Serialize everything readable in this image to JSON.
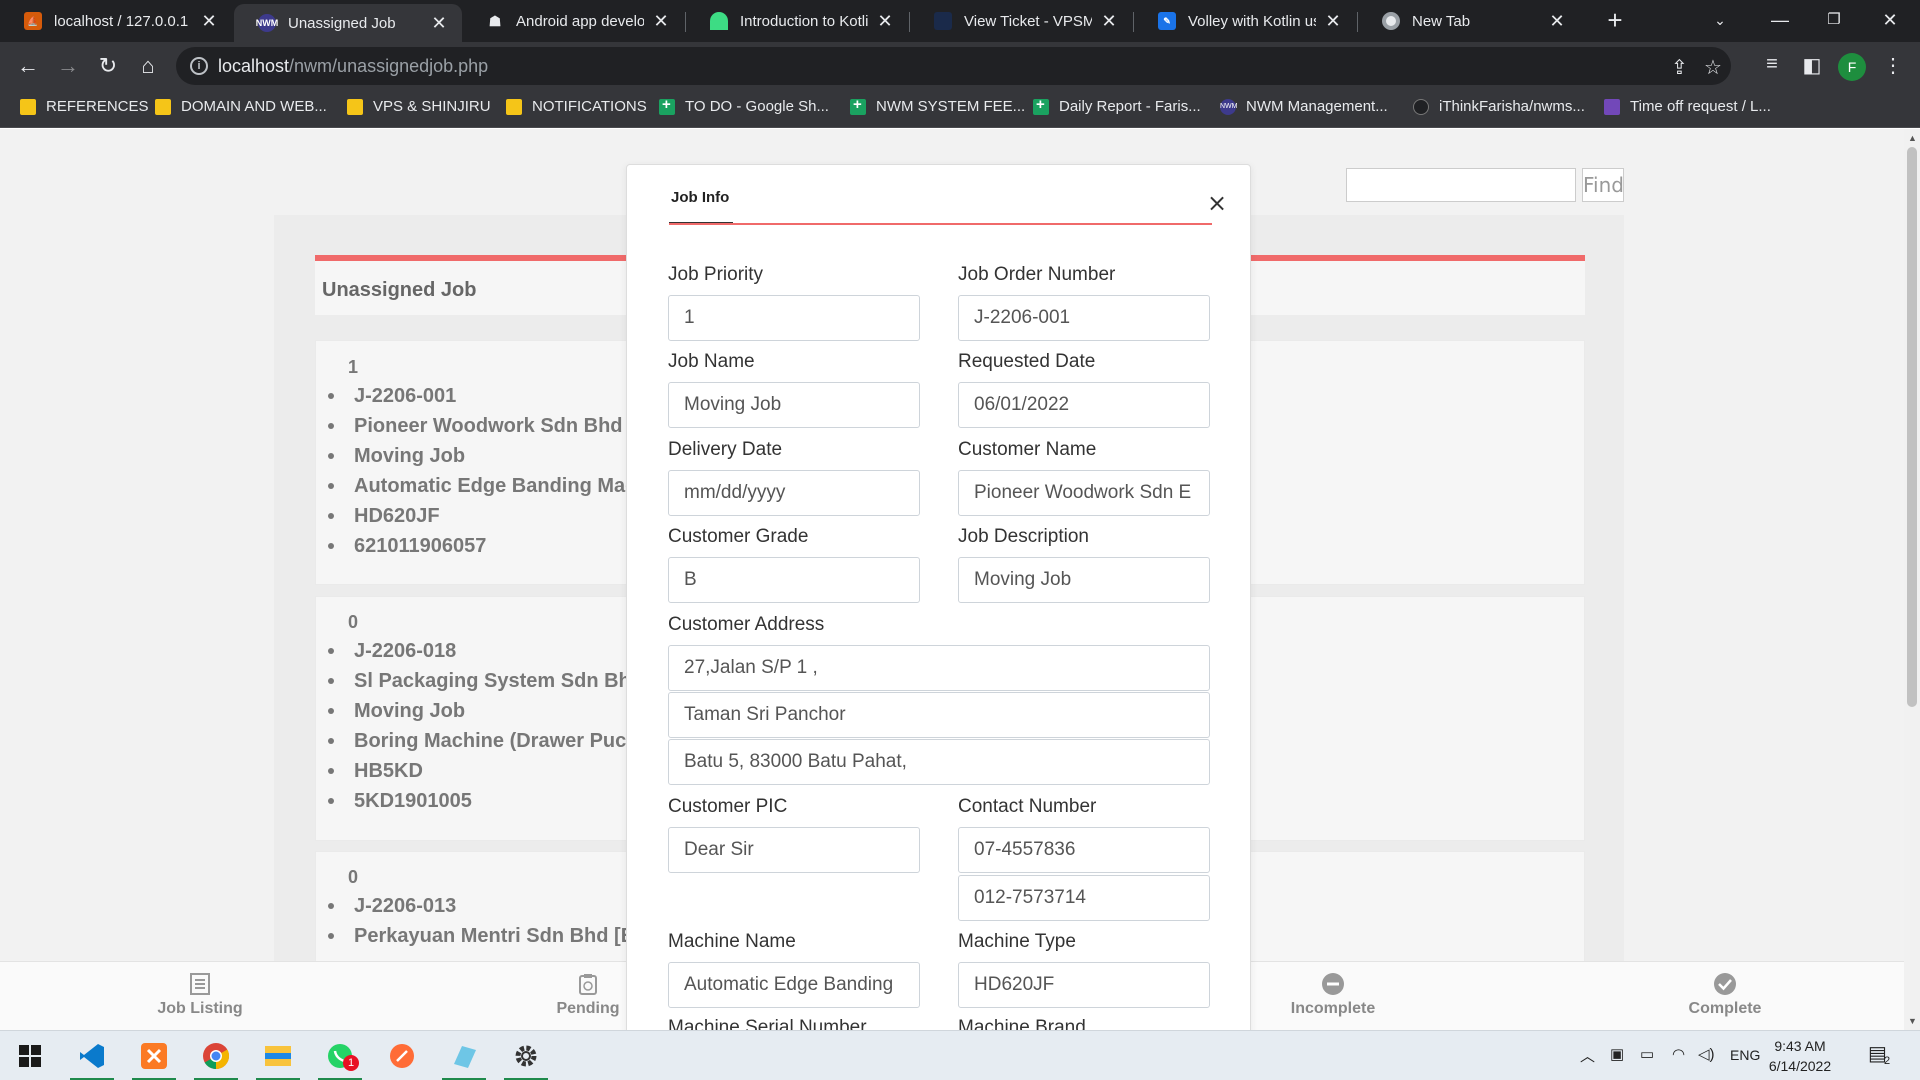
{
  "browser": {
    "tabs": [
      {
        "title": "localhost / 127.0.0.1 /",
        "favicon": "phpmyadmin-icon",
        "active": false
      },
      {
        "title": "Unassigned Job",
        "favicon": "nwm-icon",
        "active": true
      },
      {
        "title": "Android app developr",
        "favicon": "android-icon",
        "active": false
      },
      {
        "title": "Introduction to Kotlin",
        "favicon": "android-studio-icon",
        "active": false
      },
      {
        "title": "View Ticket - VPSMala",
        "favicon": "vps-icon",
        "active": false
      },
      {
        "title": "Volley with Kotlin usin",
        "favicon": "volley-icon",
        "active": false
      },
      {
        "title": "New Tab",
        "favicon": "chrome-icon",
        "active": false
      }
    ],
    "url_host": "localhost",
    "url_path": "/nwm/unassignedjob.php",
    "profile_initial": "F",
    "bookmarks": [
      {
        "label": "REFERENCES",
        "type": "folder"
      },
      {
        "label": "DOMAIN AND WEB...",
        "type": "folder"
      },
      {
        "label": "VPS & SHINJIRU",
        "type": "folder"
      },
      {
        "label": "NOTIFICATIONS",
        "type": "folder"
      },
      {
        "label": "TO DO - Google Sh...",
        "type": "sheet"
      },
      {
        "label": "NWM SYSTEM FEE...",
        "type": "sheet"
      },
      {
        "label": "Daily Report - Faris...",
        "type": "sheet"
      },
      {
        "label": "NWM Management...",
        "type": "nwm"
      },
      {
        "label": "iThinkFarisha/nwms...",
        "type": "gh"
      },
      {
        "label": "Time off request / L...",
        "type": "form"
      }
    ]
  },
  "page": {
    "find_label": "Find",
    "search_value": "",
    "panel_title": "Unassigned Job",
    "jobs": [
      {
        "priority": "1",
        "lines": [
          "J-2206-001",
          "Pioneer Woodwork Sdn Bhd [",
          "Moving Job",
          "Automatic Edge Banding Mac",
          "HD620JF",
          "621011906057"
        ]
      },
      {
        "priority": "0",
        "lines": [
          "J-2206-018",
          "Sl Packaging System Sdn Bhd",
          "Moving Job",
          "Boring Machine (Drawer Pucl",
          "HB5KD",
          "5KD1901005"
        ]
      },
      {
        "priority": "0",
        "lines": [
          "J-2206-013",
          "Perkayuan Mentri Sdn Bhd [E"
        ]
      }
    ],
    "bottom_nav": [
      {
        "label": "Job Listing",
        "icon": "list-icon"
      },
      {
        "label": "Pending",
        "icon": "clipboard-icon"
      },
      {
        "label": "Incomplete",
        "icon": "minus-circle-icon"
      },
      {
        "label": "Complete",
        "icon": "check-circle-icon"
      }
    ]
  },
  "modal": {
    "tab_label": "Job Info",
    "close_label": "×",
    "fields": {
      "job_priority": {
        "label": "Job Priority",
        "value": "1"
      },
      "job_order_number": {
        "label": "Job Order Number",
        "value": "J-2206-001"
      },
      "job_name": {
        "label": "Job Name",
        "value": "Moving Job"
      },
      "requested_date": {
        "label": "Requested Date",
        "value": "06/01/2022"
      },
      "delivery_date": {
        "label": "Delivery Date",
        "value": "mm/dd/yyyy"
      },
      "customer_name": {
        "label": "Customer Name",
        "value": "Pioneer Woodwork Sdn E"
      },
      "customer_grade": {
        "label": "Customer Grade",
        "value": "B"
      },
      "job_description": {
        "label": "Job Description",
        "value": "Moving Job"
      },
      "customer_address": {
        "label": "Customer Address",
        "line1": "27,Jalan S/P 1 ,",
        "line2": "Taman Sri Panchor",
        "line3": "Batu 5, 83000 Batu Pahat,"
      },
      "customer_pic": {
        "label": "Customer PIC",
        "value": "Dear Sir"
      },
      "contact_number": {
        "label": "Contact Number",
        "value1": "07-4557836",
        "value2": "012-7573714"
      },
      "machine_name": {
        "label": "Machine Name",
        "value": "Automatic Edge Banding"
      },
      "machine_type": {
        "label": "Machine Type",
        "value": "HD620JF"
      },
      "machine_serial_number": {
        "label": "Machine Serial Number"
      },
      "machine_brand": {
        "label": "Machine Brand"
      }
    }
  },
  "taskbar": {
    "apps": [
      "windows-start-icon",
      "vscode-icon",
      "xampp-icon",
      "chrome-icon",
      "file-explorer-icon",
      "whatsapp-icon",
      "postman-icon",
      "notepad-icon",
      "settings-icon"
    ],
    "whatsapp_badge": "1",
    "lang": "ENG",
    "time": "9:43 AM",
    "date": "6/14/2022",
    "notif_count": "2"
  },
  "colors": {
    "accent_red": "#f06a6a",
    "chrome_dark": "#202124",
    "chrome_toolbar": "#35363a",
    "profile_green": "#1e8e3e"
  }
}
